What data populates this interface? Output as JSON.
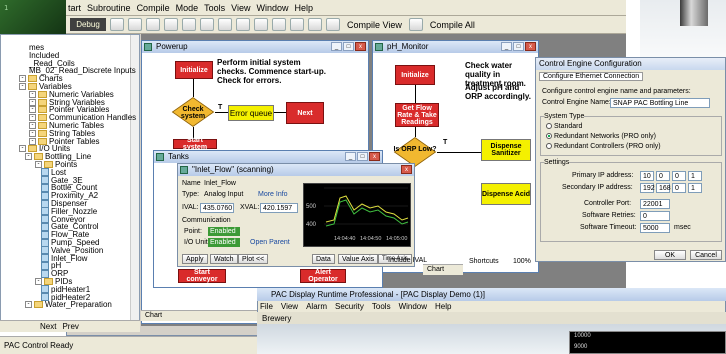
{
  "main_window": {
    "menu": [
      "tart",
      "Subroutine",
      "Compile",
      "Mode",
      "Tools",
      "View",
      "Window",
      "Help"
    ],
    "mode_badge": "Debug",
    "toolbar_text": [
      "Compile View",
      "Compile All"
    ]
  },
  "tree": {
    "items": [
      {
        "label": "mes",
        "kind": "text"
      },
      {
        "label": "Included",
        "kind": "text"
      },
      {
        "label": "_Read_Coils",
        "kind": "text"
      },
      {
        "label": "MB_02_Read_Discrete Inputs",
        "kind": "text"
      },
      {
        "label": "Charts",
        "kind": "folder"
      },
      {
        "label": "Variables",
        "kind": "folder"
      },
      {
        "label": "Numeric Variables",
        "kind": "folder"
      },
      {
        "label": "String Variables",
        "kind": "folder"
      },
      {
        "label": "Pointer Variables",
        "kind": "folder"
      },
      {
        "label": "Communication Handles",
        "kind": "folder"
      },
      {
        "label": "Numeric Tables",
        "kind": "folder"
      },
      {
        "label": "String Tables",
        "kind": "folder"
      },
      {
        "label": "Pointer Tables",
        "kind": "folder"
      },
      {
        "label": "I/O Units",
        "kind": "folder"
      },
      {
        "label": "Bottling_Line",
        "kind": "unit"
      },
      {
        "label": "Points",
        "kind": "folder"
      },
      {
        "label": "Lost",
        "kind": "point"
      },
      {
        "label": "Gate_3E",
        "kind": "point"
      },
      {
        "label": "Bottle_Count",
        "kind": "point"
      },
      {
        "label": "Proximity_A2",
        "kind": "point"
      },
      {
        "label": "Dispenser",
        "kind": "point"
      },
      {
        "label": "Filler_Nozzle",
        "kind": "point"
      },
      {
        "label": "Conveyor",
        "kind": "point"
      },
      {
        "label": "Gate_Control",
        "kind": "point"
      },
      {
        "label": "Flow_Rate",
        "kind": "point"
      },
      {
        "label": "Pump_Speed",
        "kind": "point"
      },
      {
        "label": "Valve_Position",
        "kind": "point"
      },
      {
        "label": "Inlet_Flow",
        "kind": "point"
      },
      {
        "label": "pH",
        "kind": "point"
      },
      {
        "label": "ORP",
        "kind": "point"
      },
      {
        "label": "PIDs",
        "kind": "folder"
      },
      {
        "label": "pidHeater1",
        "kind": "point"
      },
      {
        "label": "pidHeater2",
        "kind": "point"
      },
      {
        "label": "Water_Preparation",
        "kind": "unit"
      }
    ],
    "nav_next": "Next",
    "nav_prev": "Prev"
  },
  "powerup": {
    "title": "Powerup",
    "initialize": "Initialize",
    "note": "Perform initial system checks. Commence start-up. Check for errors.",
    "check_system": "Check system",
    "t_label": "T",
    "error_queue": "Error queue",
    "next": "Next",
    "start_system": "Start system"
  },
  "ph_monitor": {
    "title": "pH_Monitor",
    "initialize": "Initialize",
    "note1": "Check water quality in treatment room.",
    "note2": "Adjust pH and ORP accordingly.",
    "get_flow": "Get Flow Rate & Take Readings",
    "is_orp_low": "Is ORP Low?",
    "t_label": "T",
    "dispense_sanitizer": "Dispense Sanitizer",
    "dispense_acid": "Dispense Acid",
    "chart_tab": "Chart",
    "shortcuts": "Shortcuts",
    "zoom": "100%"
  },
  "tanks": {
    "title": "Tanks",
    "start_conveyor": "Start conveyor",
    "alert_operator": "Alert Operator",
    "chart_tab": "Chart"
  },
  "inspect": {
    "title": "\"Inlet_Flow\" (scanning)",
    "name_label": "Name",
    "name_value": "Inlet_Flow",
    "type_label": "Type:",
    "type_value": "Analog Input",
    "more_info": "More Info",
    "ival_label": "IVAL:",
    "ival_value": "435.0760",
    "xval_label": "XVAL:",
    "xval_value": "420.1597",
    "comm_label": "Communication",
    "point_label": "Point:",
    "point_state": "Enabled",
    "io_unit_label": "I/O Unit:",
    "io_unit_state": "Enabled",
    "open_parent": "Open Parent",
    "apply": "Apply",
    "watch": "Watch",
    "plot": "Plot <<",
    "data": "Data",
    "value_axis": "Value Axis",
    "time_axis": "Time Axis",
    "include_ival": "Include IVAL",
    "trend_y_ticks": [
      "500",
      "400"
    ],
    "trend_x_ticks": [
      "14:04:40",
      "14:04:50",
      "14:05:00"
    ]
  },
  "cec": {
    "title": "Control Engine Configuration",
    "tab": "Configure Ethernet Connection",
    "intro": "Configure control engine name and parameters:",
    "name_label": "Control Engine Name:",
    "name_value": "SNAP PAC Bottling Line",
    "system_type": "System Type",
    "options": [
      "Standard",
      "Redundant Networks (PRO only)",
      "Redundant Controllers (PRO only)"
    ],
    "selected_option": 1,
    "settings": "Settings",
    "primary_ip_label": "Primary IP address:",
    "primary_ip": [
      "10",
      "0",
      "0",
      "1"
    ],
    "secondary_ip_label": "Secondary IP address:",
    "secondary_ip": [
      "192",
      "168",
      "0",
      "1"
    ],
    "port_label": "Controller Port:",
    "port_value": "22001",
    "retries_label": "Software Retries:",
    "retries_value": "0",
    "timeout_label": "Software Timeout:",
    "timeout_value": "5000",
    "timeout_unit": "msec",
    "ok": "OK",
    "cancel": "Cancel"
  },
  "runtime": {
    "title": "PAC Display Runtime Professional - [PAC Display Demo (1)]",
    "menu": [
      "File",
      "View",
      "Alarm",
      "Security",
      "Tools",
      "Window",
      "Help"
    ],
    "screen": "Brewery",
    "trend_ticks": [
      "10000",
      "9000"
    ]
  },
  "status_bar": "PAC Control Ready"
}
